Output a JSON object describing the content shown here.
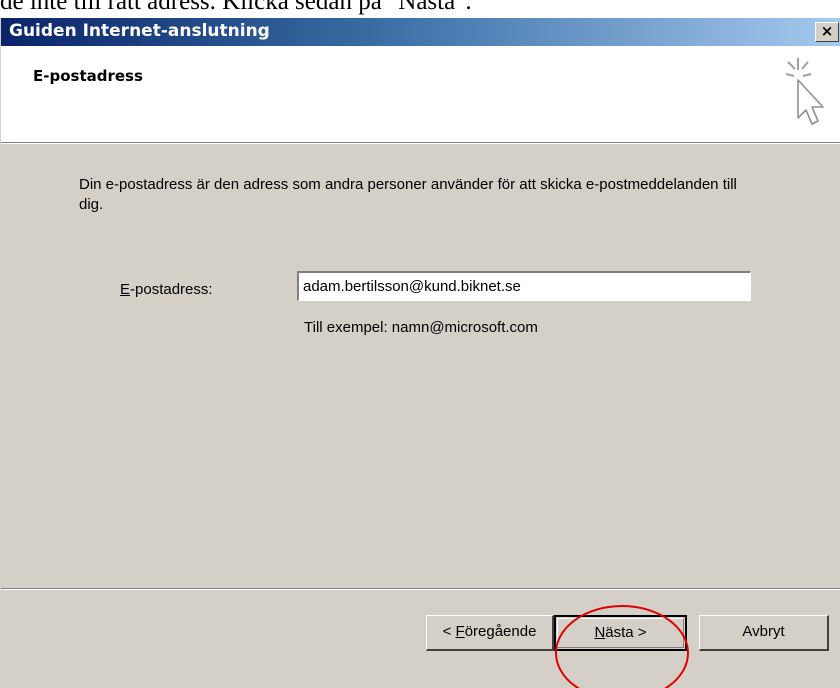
{
  "document": {
    "text_above": "de inte till rätt adress. Klicka sedan på \"Nästa\"."
  },
  "window": {
    "title": "Guiden Internet-anslutning",
    "close_glyph": "×"
  },
  "header": {
    "title": "E-postadress",
    "icon": "wizard-cursor-icon"
  },
  "body": {
    "description": "Din e-postadress är den adress som andra personer använder för att skicka e-postmeddelanden till dig.",
    "field": {
      "label_mnemonic": "E",
      "label_rest": "-postadress:",
      "value": "adam.bertilsson@kund.biknet.se"
    },
    "example": "Till exempel: namn@microsoft.com"
  },
  "buttons": {
    "back": {
      "prefix": "< ",
      "mnemonic": "F",
      "rest": "öregående"
    },
    "next": {
      "mnemonic": "N",
      "rest": "ästa >"
    },
    "cancel": {
      "label": "Avbryt"
    }
  },
  "annotation": {
    "color": "#e00000",
    "shape": "ellipse-around-next-button"
  }
}
